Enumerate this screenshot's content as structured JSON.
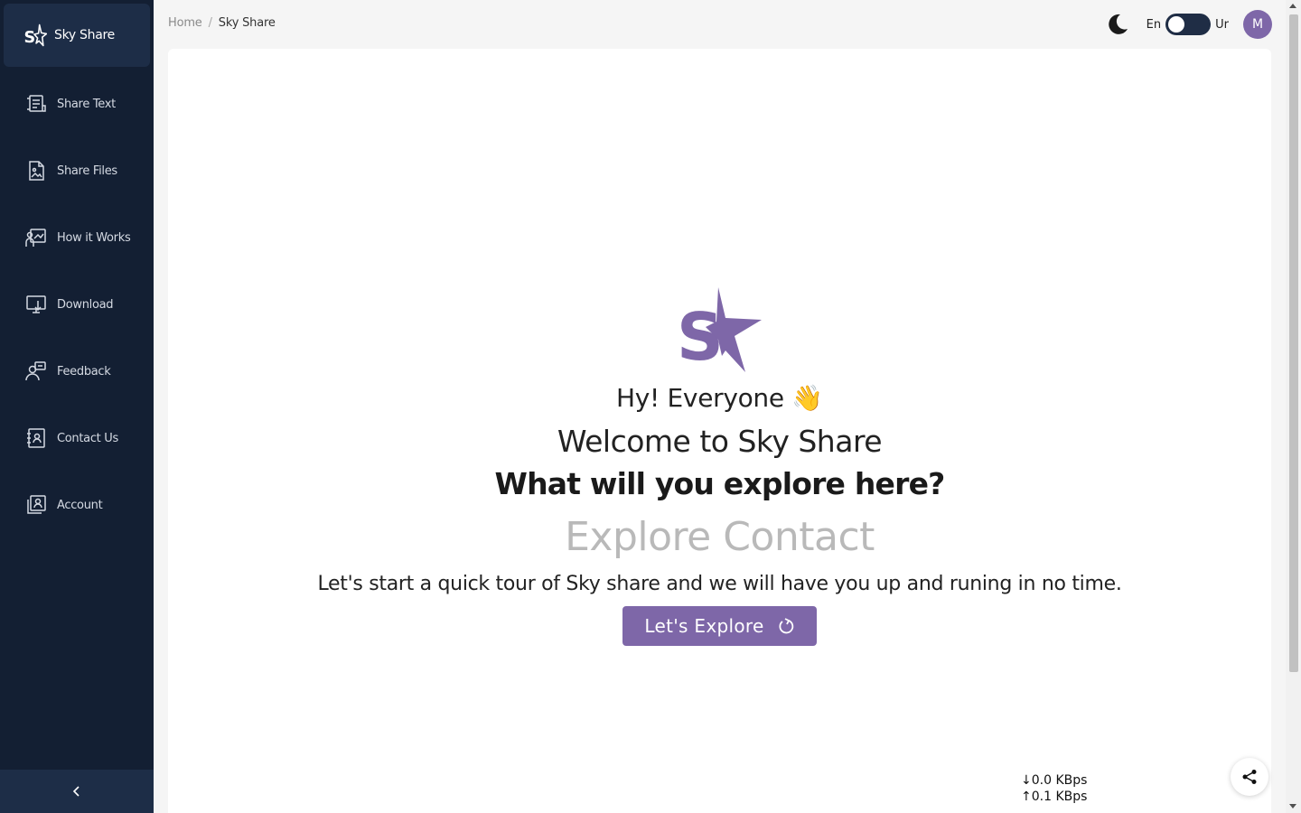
{
  "sidebar": {
    "brand": {
      "label": "Sky Share",
      "icon": "sky-share-logo-icon"
    },
    "items": [
      {
        "label": "Share Text",
        "icon": "document-text-icon"
      },
      {
        "label": "Share Files",
        "icon": "file-image-icon"
      },
      {
        "label": "How it Works",
        "icon": "presentation-icon"
      },
      {
        "label": "Download",
        "icon": "monitor-download-icon"
      },
      {
        "label": "Feedback",
        "icon": "user-feedback-icon"
      },
      {
        "label": "Contact Us",
        "icon": "contact-list-icon"
      },
      {
        "label": "Account",
        "icon": "user-stack-icon"
      }
    ],
    "collapse_icon": "chevron-left-icon"
  },
  "header": {
    "breadcrumb": {
      "home": "Home",
      "separator": "/",
      "current": "Sky Share"
    },
    "lang_left": "En",
    "lang_right": "Ur",
    "avatar_initial": "M",
    "theme_icon": "moon-icon"
  },
  "hero": {
    "greeting": "Hy!  Everyone",
    "greeting_emoji": "👋",
    "welcome": "Welcome to Sky Share",
    "question": "What will you explore here?",
    "rotating_text": "Explore Contact",
    "tour_text": "Let's start a quick tour of Sky share and we will have you up and runing in no time.",
    "button_label": "Let's Explore",
    "button_icon": "refresh-icon"
  },
  "network": {
    "download_speed": "0.0 KBps",
    "upload_speed": "0.1 KBps"
  },
  "colors": {
    "sidebar_bg": "#131f33",
    "accent": "#7e67a8",
    "muted_text": "#b9b9b9"
  }
}
